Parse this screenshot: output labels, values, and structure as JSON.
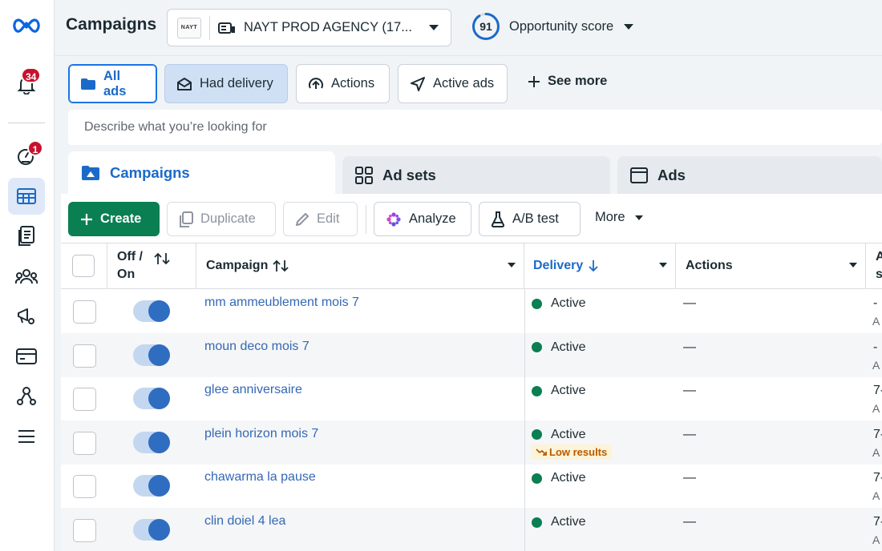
{
  "header": {
    "title": "Campaigns",
    "account": {
      "logo_text": "NAYT",
      "name": "NAYT PROD AGENCY (17..."
    },
    "opportunity": {
      "score": "91",
      "label": "Opportunity score",
      "fraction": 0.91
    }
  },
  "rail": {
    "notifications_badge": "34",
    "alerts_badge": "1",
    "icons": [
      "meta-logo-icon",
      "bell-icon",
      "alert-gauge-icon",
      "campaigns-grid-icon",
      "documents-icon",
      "audiences-icon",
      "megaphone-settings-icon",
      "billing-card-icon",
      "events-manager-icon",
      "menu-icon"
    ]
  },
  "filters": {
    "chips": [
      "All ads",
      "Had delivery",
      "Actions",
      "Active ads"
    ],
    "see_more": "See more",
    "search_placeholder": "Describe what you’re looking for"
  },
  "tabs": [
    "Campaigns",
    "Ad sets",
    "Ads"
  ],
  "toolbar": {
    "create": "Create",
    "duplicate": "Duplicate",
    "edit": "Edit",
    "analyze": "Analyze",
    "ab_test": "A/B test",
    "more": "More"
  },
  "table": {
    "columns": {
      "offon_line1": "Off /",
      "offon_line2": "On",
      "campaign": "Campaign",
      "delivery": "Delivery",
      "actions": "Actions",
      "attr_line1": "A",
      "attr_line2": "s"
    },
    "rows": [
      {
        "name": "mm ammeublement mois 7",
        "on": true,
        "delivery": "Active",
        "flag": "",
        "actions": "—",
        "edge1": "-",
        "edge2": "A"
      },
      {
        "name": "moun deco mois 7",
        "on": true,
        "delivery": "Active",
        "flag": "",
        "actions": "—",
        "edge1": "-",
        "edge2": "A"
      },
      {
        "name": "glee anniversaire",
        "on": true,
        "delivery": "Active",
        "flag": "",
        "actions": "—",
        "edge1": "7-",
        "edge2": "A"
      },
      {
        "name": "plein horizon mois 7",
        "on": true,
        "delivery": "Active",
        "flag": "Low results",
        "actions": "—",
        "edge1": "7-",
        "edge2": "A"
      },
      {
        "name": "chawarma la pause",
        "on": true,
        "delivery": "Active",
        "flag": "",
        "actions": "—",
        "edge1": "7-",
        "edge2": "A"
      },
      {
        "name": "clin doiel 4 lea",
        "on": true,
        "delivery": "Active",
        "flag": "",
        "actions": "—",
        "edge1": "7-",
        "edge2": "A"
      }
    ]
  },
  "colors": {
    "brand_blue": "#1b74e4",
    "create_green": "#0a7f52",
    "link_blue": "#3468b5",
    "active_dot": "#0a7f52",
    "badge_red": "#c8102e"
  }
}
